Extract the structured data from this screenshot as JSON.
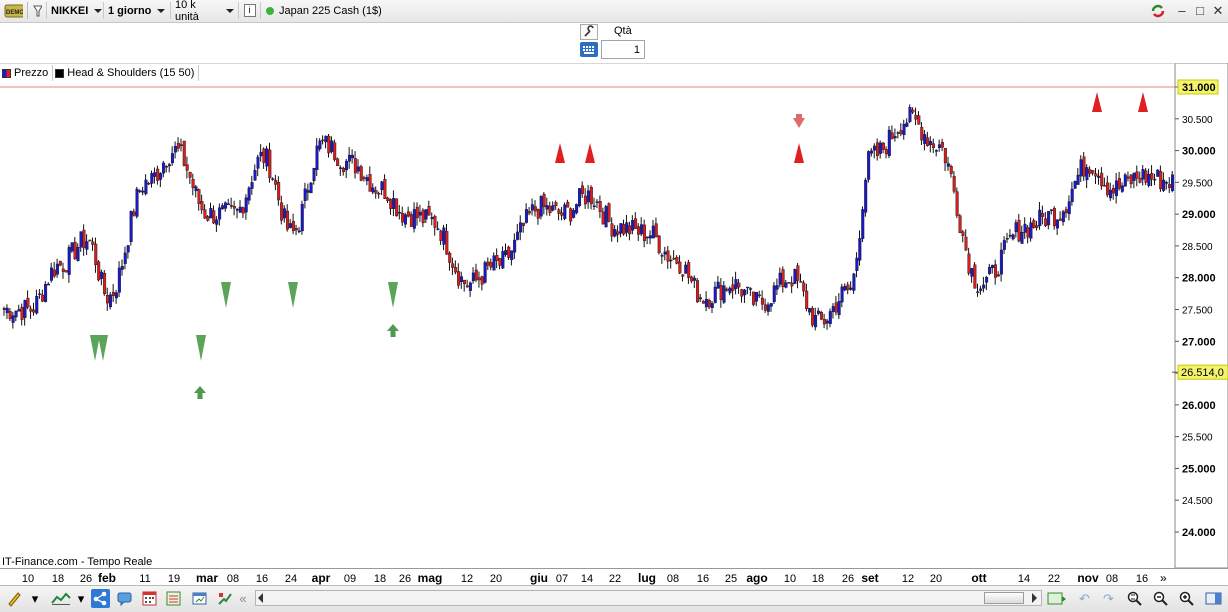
{
  "toolbar": {
    "instrument": "NIKKEI",
    "timeframe": "1 giorno",
    "units": "10 k unità",
    "info_icon": "i",
    "market_name": "Japan 225 Cash (1$)",
    "status_color": "#3cb43c"
  },
  "order": {
    "qty_label": "Qtà",
    "qty_value": "1"
  },
  "legend": {
    "price_label": "Prezzo",
    "indicator_label": "Head & Shoulders (15 50)"
  },
  "watermark": "IT-Finance.com - Tempo Reale",
  "date_axis": {
    "labels": [
      "10",
      "18",
      "26",
      "feb",
      "11",
      "19",
      "mar",
      "08",
      "16",
      "24",
      "apr",
      "09",
      "18",
      "26",
      "mag",
      "12",
      "20",
      "giu",
      "07",
      "14",
      "22",
      "lug",
      "08",
      "16",
      "25",
      "ago",
      "10",
      "18",
      "26",
      "set",
      "12",
      "20",
      "ott",
      "14",
      "22",
      "nov",
      "08",
      "16"
    ]
  },
  "price_axis": {
    "ticks": [
      "31.000",
      "30.500",
      "30.000",
      "29.500",
      "29.000",
      "28.500",
      "28.000",
      "27.500",
      "27.000",
      "26.500",
      "26.000",
      "25.500",
      "25.000",
      "24.500",
      "24.000"
    ],
    "highlight_high": "31.000",
    "highlight_last": "26.514,0"
  },
  "colors": {
    "up": "#1a1ac8",
    "down": "#d81e1e",
    "bear_signal": "#e02020",
    "bull_signal": "#5aa55a",
    "label_bg": "#f3f36e"
  },
  "chart_data": {
    "type": "candlestick",
    "ylim": [
      23700,
      31650
    ],
    "series_name": "Prezzo",
    "close_series": [
      {
        "x": "10",
        "y": 27500
      },
      {
        "x": "18",
        "y": 28200
      },
      {
        "x": "26",
        "y": 28600
      },
      {
        "x": "feb",
        "y": 27700
      },
      {
        "x": "11",
        "y": 29500
      },
      {
        "x": "19",
        "y": 30000
      },
      {
        "x": "mar",
        "y": 29000
      },
      {
        "x": "08",
        "y": 29000
      },
      {
        "x": "16",
        "y": 29900
      },
      {
        "x": "24",
        "y": 28700
      },
      {
        "x": "apr",
        "y": 30100
      },
      {
        "x": "09",
        "y": 29800
      },
      {
        "x": "18",
        "y": 29400
      },
      {
        "x": "26",
        "y": 29000
      },
      {
        "x": "mag",
        "y": 28900
      },
      {
        "x": "12",
        "y": 27900
      },
      {
        "x": "20",
        "y": 28200
      },
      {
        "x": "giu",
        "y": 29100
      },
      {
        "x": "07",
        "y": 29000
      },
      {
        "x": "14",
        "y": 29300
      },
      {
        "x": "22",
        "y": 28800
      },
      {
        "x": "lug",
        "y": 28700
      },
      {
        "x": "08",
        "y": 28300
      },
      {
        "x": "16",
        "y": 27700
      },
      {
        "x": "25",
        "y": 27900
      },
      {
        "x": "ago",
        "y": 27600
      },
      {
        "x": "10",
        "y": 28000
      },
      {
        "x": "18",
        "y": 27300
      },
      {
        "x": "26",
        "y": 27800
      },
      {
        "x": "set",
        "y": 29900
      },
      {
        "x": "12",
        "y": 30500
      },
      {
        "x": "20",
        "y": 30100
      },
      {
        "x": "ott",
        "y": 27900
      },
      {
        "x": "14",
        "y": 28800
      },
      {
        "x": "22",
        "y": 29000
      },
      {
        "x": "nov",
        "y": 29800
      },
      {
        "x": "08",
        "y": 29400
      },
      {
        "x": "16",
        "y": 29600
      }
    ],
    "bearish_signals": [
      "giu",
      "14",
      "10",
      "nov",
      "16"
    ],
    "bullish_signals": [
      "feb",
      "mar",
      "24",
      "18"
    ],
    "reference_line": 31000,
    "last_price": 26514
  }
}
